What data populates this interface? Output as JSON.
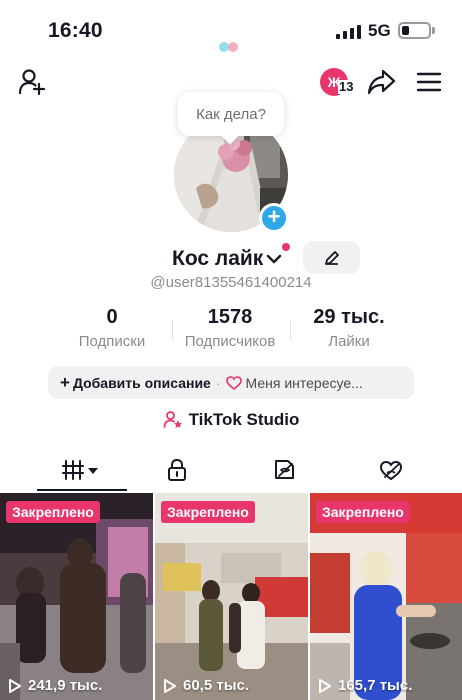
{
  "status_bar": {
    "time": "16:40",
    "network": "5G"
  },
  "header": {
    "avatar_letter": "Ж",
    "avatar_count": "13"
  },
  "bubble": {
    "text": "Как дела?"
  },
  "profile": {
    "name": "Кос лайк",
    "handle": "@user81355461400214",
    "stats": [
      {
        "value": "0",
        "label": "Подписки"
      },
      {
        "value": "1578",
        "label": "Подписчиков"
      },
      {
        "value": "29 тыс.",
        "label": "Лайки"
      }
    ],
    "add_description": "Добавить описание",
    "interests": "Меня интересуе...",
    "studio": "TikTok Studio"
  },
  "tabs": [
    "grid-icon",
    "lock-icon",
    "tagged-icon",
    "liked-icon"
  ],
  "videos": [
    {
      "pinned_label": "Закреплено",
      "views": "241,9 тыс."
    },
    {
      "pinned_label": "Закреплено",
      "views": "60,5 тыс."
    },
    {
      "pinned_label": "Закреплено",
      "views": "165,7 тыс."
    }
  ],
  "colors": {
    "accent": "#e8356b",
    "plus_blue": "#2fa8e8",
    "text": "#161823",
    "muted": "#8a8b91"
  }
}
